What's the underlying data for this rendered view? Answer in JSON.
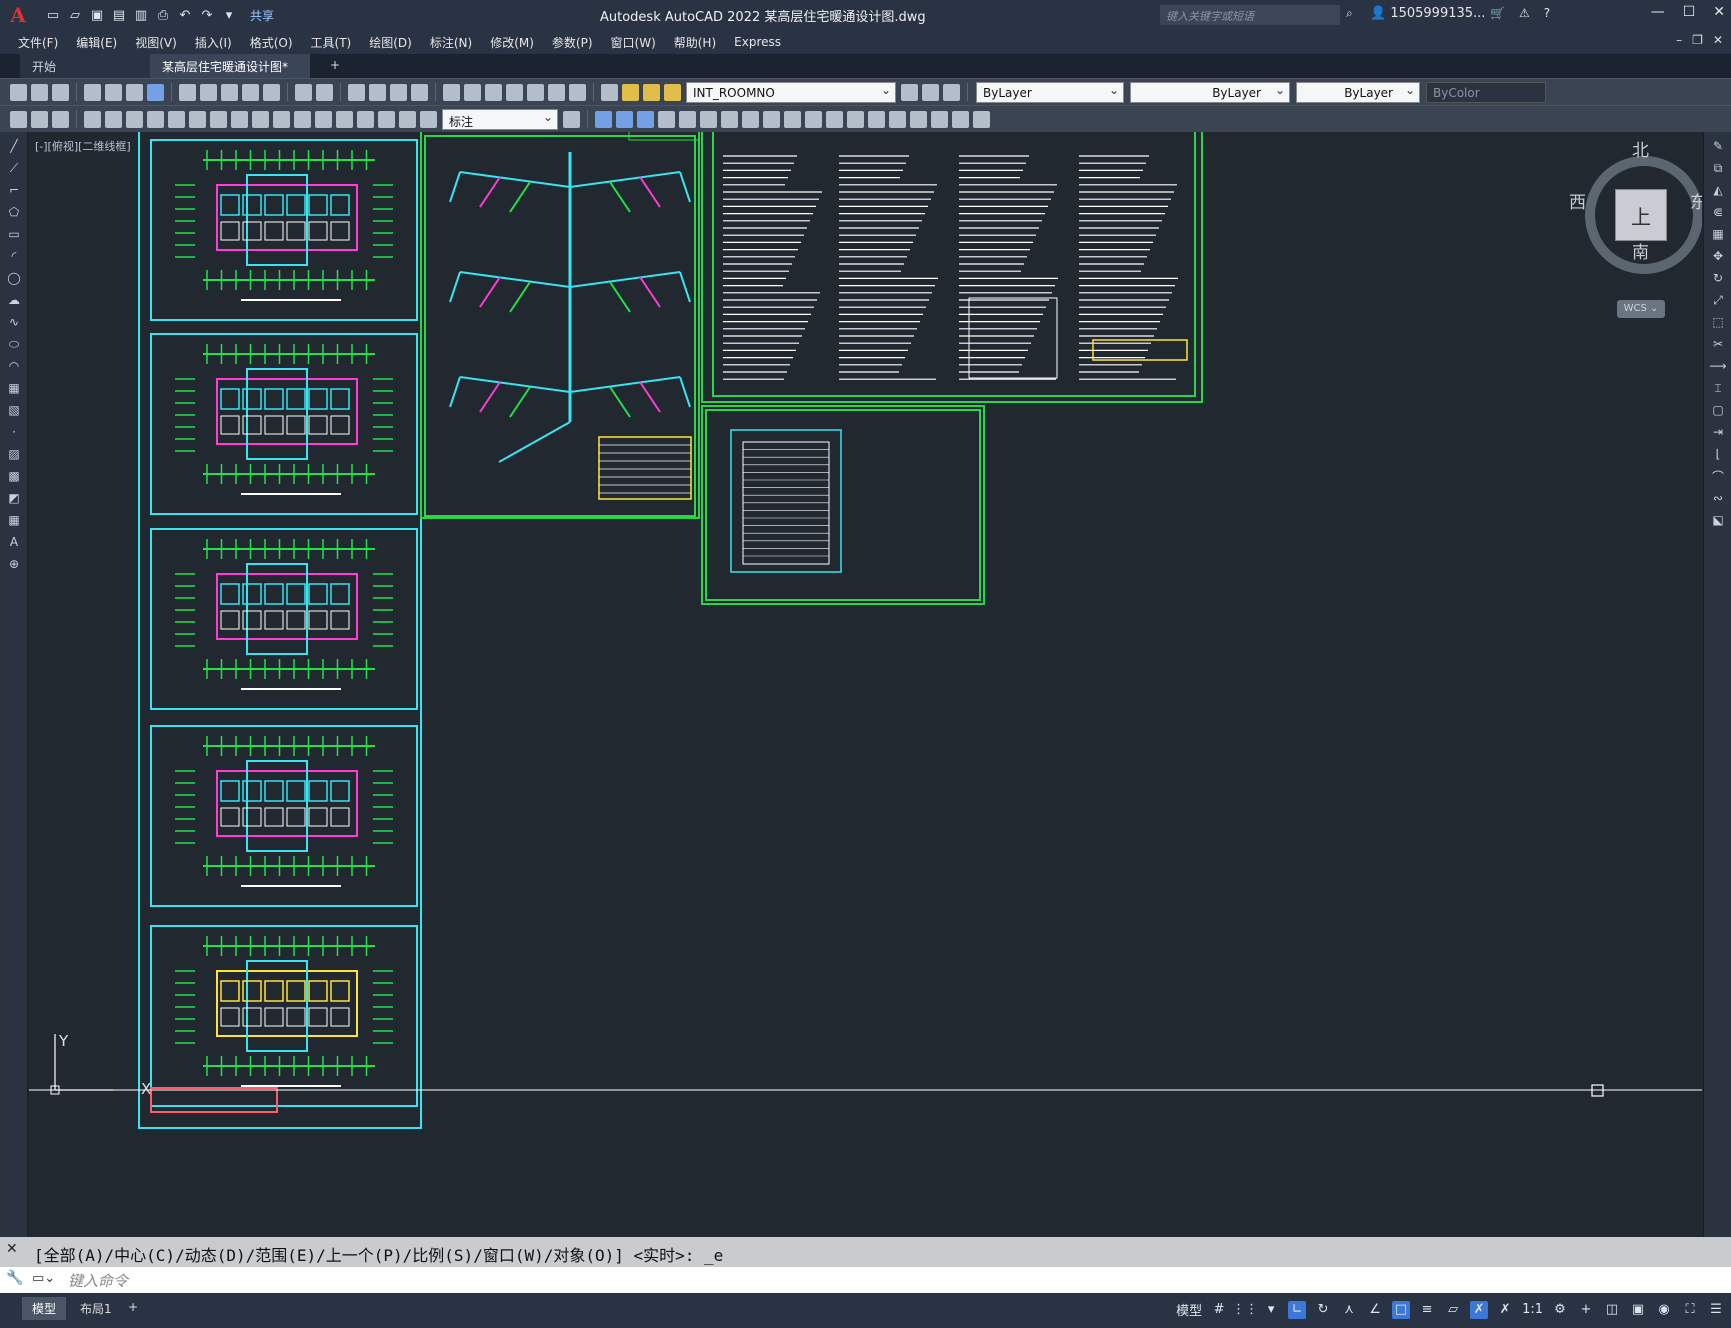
{
  "titlebar": {
    "app_title": "Autodesk AutoCAD 2022    某高层住宅暖通设计图.dwg",
    "share_label": "共享",
    "search_placeholder": "键入关键字或短语",
    "user": "1505999135...",
    "help": "?"
  },
  "menu": [
    "文件(F)",
    "编辑(E)",
    "视图(V)",
    "插入(I)",
    "格式(O)",
    "工具(T)",
    "绘图(D)",
    "标注(N)",
    "修改(M)",
    "参数(P)",
    "窗口(W)",
    "帮助(H)",
    "Express"
  ],
  "tabs": {
    "start": "开始",
    "document": "某高层住宅暖通设计图*",
    "add": "+"
  },
  "toolbar": {
    "layer_value": "INT_ROOMNO",
    "color_value": "ByLayer",
    "linetype_value": "ByLayer",
    "lineweight_value": "ByLayer",
    "plotstyle_value": "ByColor",
    "dimstyle_value": "标注"
  },
  "viewport": {
    "label": "[-][俯视][二维线框]",
    "viewcube": {
      "top": "上",
      "north": "北",
      "south": "南",
      "east": "东",
      "west": "西",
      "wcs": "WCS"
    },
    "ucs": {
      "x": "X",
      "y": "Y"
    }
  },
  "command": {
    "history": "[全部(A)/中心(C)/动态(D)/范围(E)/上一个(P)/比例(S)/窗口(W)/对象(O)] <实时>: _e",
    "placeholder": "键入命令"
  },
  "status": {
    "model_tab": "模型",
    "layout_tab": "布局1",
    "add_tab": "+",
    "model_label": "模型",
    "scale": "1:1"
  },
  "colors": {
    "drawing_bg": "#212830",
    "frame_cyan": "#39e3f0",
    "frame_green": "#29d64a",
    "grid_green": "#22e04a",
    "wall_magenta": "#ff3dd6",
    "wall_yellow": "#ffe23a",
    "text_white": "#ffffff"
  }
}
